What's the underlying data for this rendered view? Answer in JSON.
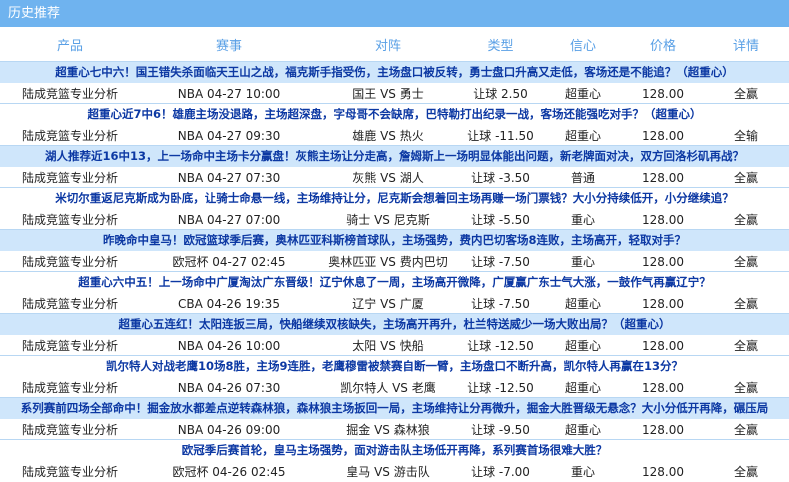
{
  "header": {
    "title": "历史推荐"
  },
  "columns": [
    "产品",
    "赛事",
    "对阵",
    "类型",
    "信心",
    "价格",
    "详情"
  ],
  "rows": [
    {
      "title": "超重心七中六！国王错失杀面临天王山之战，福克斯手指受伤，主场盘口被反转，勇士盘口升高又走低，客场还是不能追？（超重心）",
      "product": "陆成竞篮专业分析",
      "match": "NBA 04-27 10:00",
      "teams": "国王 VS 勇士",
      "type": "让球 2.50",
      "confidence": "超重心",
      "price": "128.00",
      "result": "全赢"
    },
    {
      "title": "超重心近7中6！雄鹿主场没退路，主场超深盘，字母哥不会缺席，巴特勒打出纪录一战，客场还能强吃对手？（超重心）",
      "product": "陆成竞篮专业分析",
      "match": "NBA 04-27 09:30",
      "teams": "雄鹿 VS 热火",
      "type": "让球 -11.50",
      "confidence": "超重心",
      "price": "128.00",
      "result": "全输"
    },
    {
      "title": "湖人推荐近16中13，上一场命中主场卡分赢盘！灰熊主场让分走高，詹姆斯上一场明显体能出问题，新老牌面对决，双方回洛杉矶再战？",
      "product": "陆成竞篮专业分析",
      "match": "NBA 04-27 07:30",
      "teams": "灰熊 VS 湖人",
      "type": "让球 -3.50",
      "confidence": "普通",
      "price": "128.00",
      "result": "全赢"
    },
    {
      "title": "米切尔重返尼克斯成为卧底，让骑士命悬一线，主场维持让分，尼克斯会想着回主场再赚一场门票钱？大小分持续低开，小分继续追？",
      "product": "陆成竞篮专业分析",
      "match": "NBA 04-27 07:00",
      "teams": "骑士 VS 尼克斯",
      "type": "让球 -5.50",
      "confidence": "重心",
      "price": "128.00",
      "result": "全赢"
    },
    {
      "title": "昨晚命中皇马！欧冠篮球季后赛，奥林匹亚科斯榜首球队，主场强势，费内巴切客场8连败，主场高开，轻取对手？",
      "product": "陆成竞篮专业分析",
      "match": "欧冠杯 04-27 02:45",
      "teams": "奥林匹亚 VS 费内巴切",
      "type": "让球 -7.50",
      "confidence": "重心",
      "price": "128.00",
      "result": "全赢"
    },
    {
      "title": "超重心六中五！上一场命中广厦淘汰广东晋级！辽宁休息了一周，主场高开微降，广厦赢广东士气大涨，一鼓作气再赢辽宁？",
      "product": "陆成竞篮专业分析",
      "match": "CBA 04-26 19:35",
      "teams": "辽宁 VS 广厦",
      "type": "让球 -7.50",
      "confidence": "超重心",
      "price": "128.00",
      "result": "全赢"
    },
    {
      "title": "超重心五连红！太阳连扳三局，快船继续双核缺失，主场高开再升，杜兰特送威少一场大败出局？（超重心）",
      "product": "陆成竞篮专业分析",
      "match": "NBA 04-26 10:00",
      "teams": "太阳 VS 快船",
      "type": "让球 -12.50",
      "confidence": "超重心",
      "price": "128.00",
      "result": "全赢"
    },
    {
      "title": "凯尔特人对战老鹰10场8胜，主场9连胜，老鹰穆雷被禁赛自断一臂，主场盘口不断升高，凯尔特人再赢在13分？",
      "product": "陆成竞篮专业分析",
      "match": "NBA 04-26 07:30",
      "teams": "凯尔特人 VS 老鹰",
      "type": "让球 -12.50",
      "confidence": "超重心",
      "price": "128.00",
      "result": "全赢"
    },
    {
      "title": "系列赛前四场全部命中！掘金放水都差点逆转森林狼，森林狼主场扳回一局，主场维持让分再微升，掘金大胜晋级无悬念？大小分低开再降，碾压局",
      "product": "陆成竞篮专业分析",
      "match": "NBA 04-26 09:00",
      "teams": "掘金 VS 森林狼",
      "type": "让球 -9.50",
      "confidence": "超重心",
      "price": "128.00",
      "result": "全赢"
    },
    {
      "title": "欧冠季后赛首轮，皇马主场强势，面对游击队主场低开再降，系列赛首场很难大胜？",
      "product": "陆成竞篮专业分析",
      "match": "欧冠杯 04-26 02:45",
      "teams": "皇马 VS 游击队",
      "type": "让球 -7.00",
      "confidence": "重心",
      "price": "128.00",
      "result": "全赢"
    }
  ]
}
